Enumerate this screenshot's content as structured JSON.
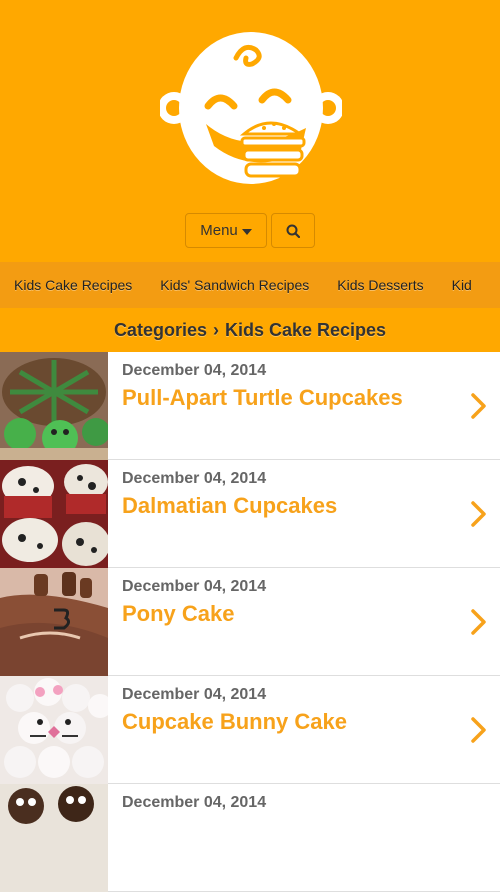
{
  "header": {
    "menu_label": "Menu",
    "logo_icon": "baby-burger-logo-icon",
    "search_icon": "search-icon"
  },
  "nav": {
    "items": [
      {
        "label": "Kids Cake Recipes"
      },
      {
        "label": "Kids' Sandwich Recipes"
      },
      {
        "label": "Kids Desserts"
      },
      {
        "label": "Kid"
      }
    ]
  },
  "breadcrumb": {
    "root": "Categories",
    "separator": "›",
    "current": "Kids Cake Recipes"
  },
  "recipes": [
    {
      "date": "December 04, 2014",
      "title": "Pull-Apart Turtle Cupcakes"
    },
    {
      "date": "December 04, 2014",
      "title": "Dalmatian Cupcakes"
    },
    {
      "date": "December 04, 2014",
      "title": "Pony Cake"
    },
    {
      "date": "December 04, 2014",
      "title": "Cupcake Bunny Cake"
    },
    {
      "date": "December 04, 2014",
      "title": ""
    }
  ],
  "colors": {
    "brand": "#FFA800",
    "nav_bg": "#F39C12",
    "title_orange": "#F7A21B",
    "date_gray": "#666666"
  }
}
